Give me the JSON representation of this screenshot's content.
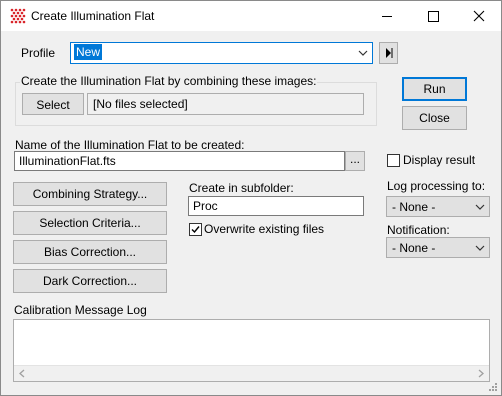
{
  "window": {
    "title": "Create Illumination Flat"
  },
  "profile": {
    "label": "Profile",
    "value": "New"
  },
  "combine_group": {
    "caption": "Create the Illumination Flat by combining these images:",
    "select_button": "Select",
    "files_display": "[No files selected]"
  },
  "actions": {
    "run": "Run",
    "close": "Close"
  },
  "name_section": {
    "label": "Name of the Illumination Flat to be created:",
    "value": "IlluminationFlat.fts",
    "browse_label": "..."
  },
  "display_result": {
    "label": "Display result",
    "checked": false
  },
  "option_buttons": {
    "combining": "Combining Strategy...",
    "selection": "Selection Criteria...",
    "bias": "Bias Correction...",
    "dark": "Dark Correction..."
  },
  "subfolder": {
    "label": "Create in subfolder:",
    "value": "Proc",
    "overwrite_label": "Overwrite existing files",
    "overwrite_checked": true
  },
  "log_processing": {
    "label": "Log processing to:",
    "value": "- None -"
  },
  "notification": {
    "label": "Notification:",
    "value": "- None -"
  },
  "message_log": {
    "label": "Calibration Message Log"
  },
  "colors": {
    "accent": "#0078d7",
    "selection_bg": "#0078d7",
    "icon_red": "#d9242a"
  }
}
